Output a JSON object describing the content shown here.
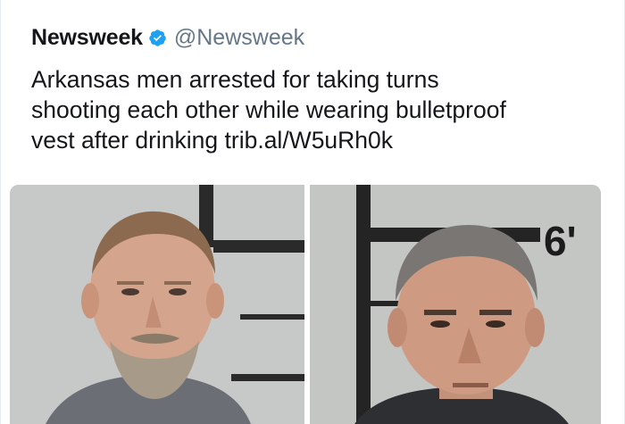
{
  "tweet": {
    "author_name": "Newsweek",
    "author_handle": "@Newsweek",
    "text": "Arkansas men arrested for taking turns\nshooting each other while wearing bulletproof\nvest after drinking trib.al/W5uRh0k",
    "verified_icon": "verified-badge-icon",
    "verified_color": "#1da1f2"
  },
  "media": {
    "photos": [
      {
        "name": "mugshot-left"
      },
      {
        "name": "mugshot-right",
        "height_mark": "6'"
      }
    ]
  }
}
